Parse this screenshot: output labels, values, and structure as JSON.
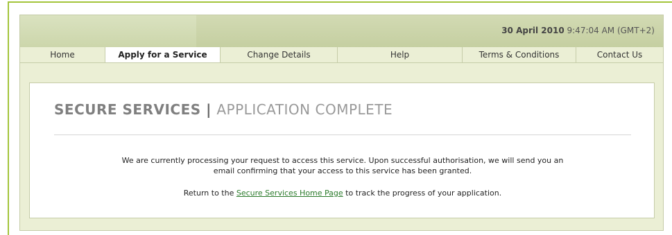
{
  "header": {
    "date_bold": "30 April 2010",
    "time": " 9:47:04 AM (GMT+2)"
  },
  "nav": {
    "items": [
      {
        "label": "Home"
      },
      {
        "label": "Apply for a Service"
      },
      {
        "label": "Change Details"
      },
      {
        "label": "Help"
      },
      {
        "label": "Terms & Conditions"
      },
      {
        "label": "Contact Us"
      }
    ],
    "active": "Apply for a Service"
  },
  "main": {
    "title_strong": "SECURE SERVICES",
    "title_separator": " | ",
    "title_sub": "APPLICATION COMPLETE",
    "message_line1": "We are currently processing your request to access this service. Upon successful authorisation, we will send you an",
    "message_line2": "email confirming that your access to this service has been granted.",
    "return_prefix": "Return to the ",
    "return_link": "Secure Services Home Page",
    "return_suffix": " to track the progress of your application."
  },
  "colors": {
    "accent_green": "#a3c43a",
    "link_green": "#2a7a2a",
    "panel_bg": "#ebefd5"
  }
}
